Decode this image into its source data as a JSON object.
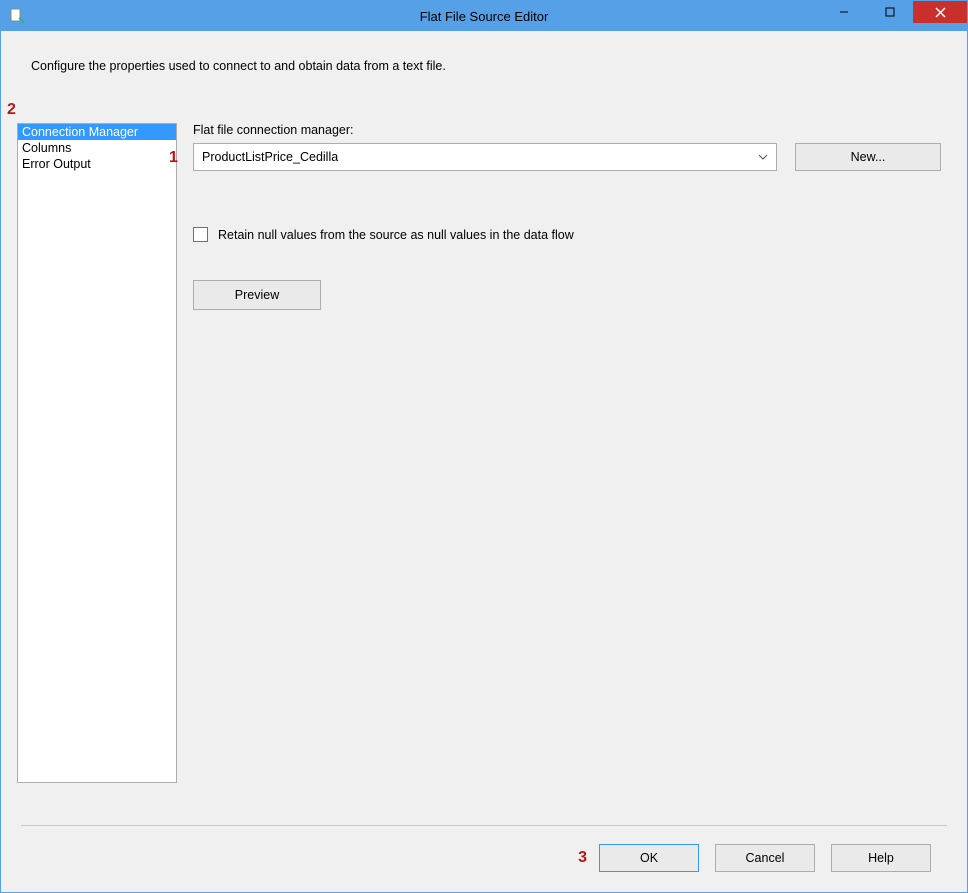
{
  "window": {
    "title": "Flat File Source Editor"
  },
  "description": "Configure the properties used to connect to and obtain data from a text file.",
  "sidebar": {
    "items": [
      {
        "label": "Connection Manager",
        "selected": true
      },
      {
        "label": "Columns",
        "selected": false
      },
      {
        "label": "Error Output",
        "selected": false
      }
    ]
  },
  "content": {
    "connectionLabel": "Flat file connection manager:",
    "connectionValue": "ProductListPrice_Cedilla",
    "newButton": "New...",
    "retainNullsLabel": "Retain null values from the source as null values in the data flow",
    "previewButton": "Preview"
  },
  "footer": {
    "ok": "OK",
    "cancel": "Cancel",
    "help": "Help"
  },
  "annotations": {
    "a1": "1",
    "a2": "2",
    "a3": "3"
  }
}
